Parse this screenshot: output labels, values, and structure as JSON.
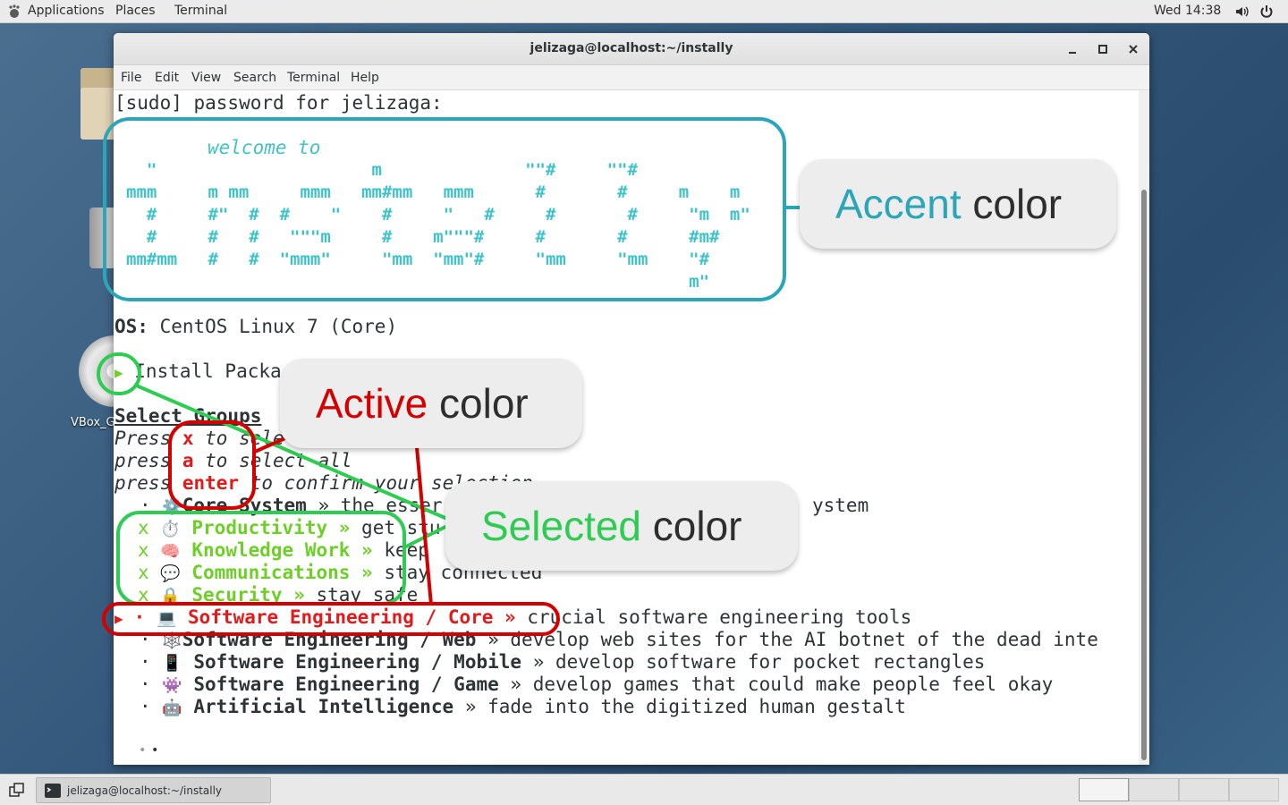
{
  "topbar": {
    "applications": "Applications",
    "places": "Places",
    "terminal": "Terminal",
    "clock": "Wed 14:38"
  },
  "desktop": {
    "vbox_label": "VBox_G"
  },
  "window": {
    "title": "jelizaga@localhost:~/instally",
    "menu": [
      "File",
      "Edit",
      "View",
      "Search",
      "Terminal",
      "Help"
    ]
  },
  "terminal": {
    "sudo_prompt": "[sudo] password for jelizaga:",
    "welcome": "welcome to",
    "ascii_art": [
      "  \"                     m              \"\"#     \"\"#",
      "mmm     m mm     mmm   mm#mm   mmm      #       #     m    m",
      "  #     #\"  #  #    \"    #     \"   #     #       #     \"m  m\"",
      "  #     #   #   \"\"\"m     #    m\"\"\"#     #       #      #m#",
      "mm#mm   #   #  \"mmm\"     \"mm  \"mm\"#     \"mm     \"mm    \"#",
      "                                                       m\""
    ],
    "os_label": "OS:",
    "os_value": " CentOS Linux 7 (Core)",
    "arrow": "▶",
    "install_packages": " Install Packa",
    "select_groups": "Select Groups",
    "press1_a": "Press ",
    "press1_key": "x",
    "press1_b": " to sele",
    "press2_a": "press ",
    "press2_key": "a",
    "press2_b": " to select all",
    "press3_a": "press ",
    "press3_key": "enter",
    "press3_b": " to confirm your selection",
    "groups": [
      {
        "mark": "·",
        "icon": "⚙️",
        "name": "Core System",
        "sep": " » ",
        "desc": "the esser",
        "tail": "ystem"
      },
      {
        "mark": "x",
        "icon": "⏱️",
        "name": "Productivity",
        "sep": " » ",
        "desc": "get stu"
      },
      {
        "mark": "x",
        "icon": "🧠",
        "name": "Knowledge Work",
        "sep": " » ",
        "desc": "keep"
      },
      {
        "mark": "x",
        "icon": "💬",
        "name": "Communications",
        "sep": " » ",
        "desc": "stay connected"
      },
      {
        "mark": "x",
        "icon": "🔒",
        "name": "Security",
        "sep": " » ",
        "desc": "stay safe"
      },
      {
        "mark": "·",
        "cursor": "▶",
        "icon": "💻",
        "name": "Software Engineering / Core",
        "sep": " » ",
        "desc": "crucial software engineering tools"
      },
      {
        "mark": "·",
        "icon": "🕸️",
        "name": "Software Engineering / Web",
        "sep": " » ",
        "desc": "develop web sites for the AI botnet of the dead inte"
      },
      {
        "mark": "·",
        "icon": "📱",
        "name": "Software Engineering / Mobile",
        "sep": " » ",
        "desc": "develop software for pocket rectangles"
      },
      {
        "mark": "·",
        "icon": "👾",
        "name": "Software Engineering / Game",
        "sep": " » ",
        "desc": "develop games that could make people feel okay"
      },
      {
        "mark": "·",
        "icon": "🤖",
        "name": "Artificial Intelligence",
        "sep": " » ",
        "desc": "fade into the digitized human gestalt"
      }
    ],
    "pager": "•",
    "pager_active": "•"
  },
  "annotations": {
    "accent_word": "Accent",
    "active_word": "Active",
    "selected_word": "Selected",
    "color_word": " color",
    "colors": {
      "accent": "#2aa6b8",
      "active": "#d40000",
      "selected": "#2ecc52"
    }
  },
  "taskbar": {
    "item_label": "jelizaga@localhost:~/instally"
  }
}
